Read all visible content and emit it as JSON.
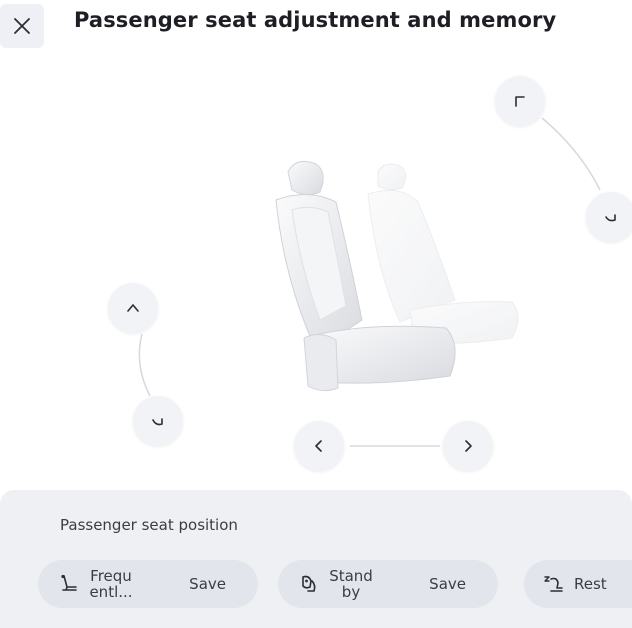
{
  "header": {
    "title": "Passenger seat adjustment and memory"
  },
  "memory_panel": {
    "title": "Passenger seat position",
    "presets": [
      {
        "label": "Frequ entl...",
        "save_label": "Save",
        "icon": "seat-recline-icon"
      },
      {
        "label": "Stand by",
        "save_label": "Save",
        "icon": "seat-standby-icon"
      },
      {
        "label": "Rest",
        "icon": "seat-rest-icon"
      }
    ]
  },
  "colors": {
    "button_bg": "#f2f3f6",
    "panel_bg": "#eef0f4",
    "pill_bg": "#e2e5ec",
    "text": "#1d1f24"
  }
}
